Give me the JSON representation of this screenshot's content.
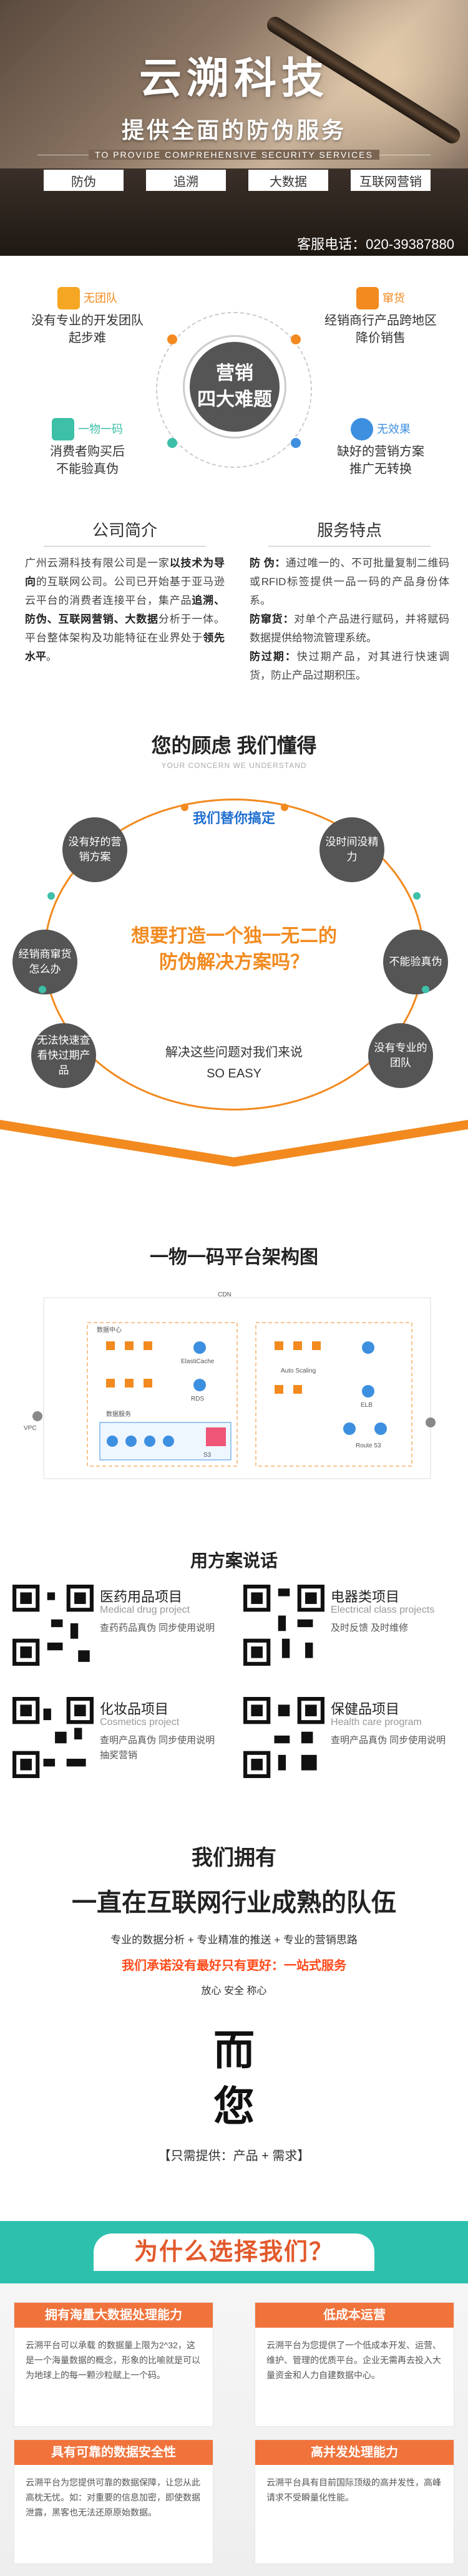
{
  "hero": {
    "brand": "云溯科技",
    "tagline": "提供全面的防伪服务",
    "slogan_en": "TO PROVIDE COMPREHENSIVE SECURITY SERVICES",
    "tags": [
      "防伪",
      "追溯",
      "大数据",
      "互联网营销"
    ],
    "contact": "客服电话：020-39387880"
  },
  "difficulties": {
    "hub_line1": "营销",
    "hub_line2": "四大难题",
    "items": [
      {
        "tag": "无团队",
        "line1": "没有专业的开发团队",
        "line2": "起步难"
      },
      {
        "tag": "窜货",
        "line1": "经销商行产品跨地区",
        "line2": "降价销售"
      },
      {
        "tag": "一物一码",
        "line1": "消费者购买后",
        "line2": "不能验真伪"
      },
      {
        "tag": "无效果",
        "line1": "缺好的营销方案",
        "line2": "推广无转换"
      }
    ]
  },
  "intro": {
    "company_title": "公司简介",
    "company_text_1": "广州云溯科技有限公司是一家",
    "company_text_2": "以技术为导向",
    "company_text_3": "的互联网公司。公司已开始基于亚马逊云平台的消费者连接平台，集产品",
    "company_text_4": "追溯、防伪、互联网营销、大数据",
    "company_text_5": "分析于一体。平台整体架构及功能特征在业界处于",
    "company_text_6": "领先水平",
    "company_text_7": "。",
    "service_title": "服务特点",
    "service_p1_label": "防 伪：",
    "service_p1": "通过唯一的、不可批量复制二维码或RFID标签提供一品一码的产品身份体系。",
    "service_p2_label": "防窜货：",
    "service_p2": "对单个产品进行赋码，并将赋码数据提供给物流管理系统。",
    "service_p3_label": "防过期：",
    "service_p3": "快过期产品，对其进行快速调货，防止产品过期积压。"
  },
  "concern": {
    "title": "您的顾虑 我们懂得",
    "subtitle": "YOUR CONCERN WE UNDERSTAND",
    "top_label": "我们替你搞定",
    "bubbles": [
      "没有好的营销方案",
      "没时间没精力",
      "经销商窜货怎么办",
      "不能验真伪",
      "无法快速查看快过期产品",
      "没有专业的团队"
    ],
    "question_1": "想要打造一个独一无二的",
    "question_2": "防伪解决方案吗？",
    "answer_1": "解决这些问题对我们来说",
    "answer_2": "SO EASY"
  },
  "platform": {
    "title": "一物一码平台架构图",
    "labels": [
      "CDN",
      "VPC",
      "数据中心",
      "数据服务",
      "RDS",
      "ElastiCache",
      "S3",
      "Auto Scaling",
      "Route 53",
      "ELB"
    ]
  },
  "cases": {
    "title": "用方案说话",
    "items": [
      {
        "name": "医药用品项目",
        "en": "Medical drug project",
        "desc": "查药药品真伪 同步使用说明"
      },
      {
        "name": "电器类项目",
        "en": "Electrical class projects",
        "desc": "及时反馈 及时维修"
      },
      {
        "name": "化妆品项目",
        "en": "Cosmetics project",
        "desc": "查明产品真伪 同步使用说明 抽奖营销"
      },
      {
        "name": "保健品项目",
        "en": "Health care program",
        "desc": "查明产品真伪 同步使用说明"
      }
    ]
  },
  "team": {
    "line1": "我们拥有",
    "line2": "一直在互联网行业成熟的队伍",
    "line3": "专业的数据分析 + 专业精准的推送 + 专业的营销思路",
    "line4": "我们承诺没有最好只有更好：一站式服务",
    "line5": "放心 安全 称心",
    "calli_1": "而",
    "calli_2": "您",
    "only": "【只需提供：产品 + 需求】"
  },
  "why": {
    "title": "为什么选择我们？",
    "boxes": [
      {
        "title": "拥有海量大数据处理能力",
        "text": "云溯平台可以承载 的数据量上限为2^32，这是一个海量数据的概念，形象的比喻就是可以为地球上的每一颗沙粒赋上一个码。"
      },
      {
        "title": "低成本运营",
        "text": "云溯平台为您提供了一个低成本开发、运营、维护、管理的优质平台。企业无需再去投入大量资金和人力自建数据中心。"
      },
      {
        "title": "具有可靠的数据安全性",
        "text": "云溯平台为您提供可靠的数据保障，让您从此高枕无忧。如：对重要的信息加密，即使数据泄露，黑客也无法还原原始数据。"
      },
      {
        "title": "高并发处理能力",
        "text": "云溯平台具有目前国际顶级的高并发性，高峰请求不受瞬量化性能。"
      }
    ]
  },
  "colors": {
    "accent": "#f28a1f",
    "teal": "#2dc1ad",
    "blue": "#1f6fd1",
    "red": "#ff4a1a"
  }
}
